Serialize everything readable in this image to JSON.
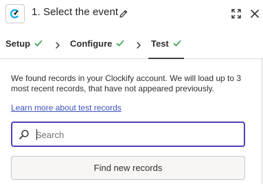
{
  "header": {
    "title": "1. Select the event",
    "app_icon": "clockify-logo-icon",
    "edit_icon": "pencil-icon",
    "expand_icon": "expand-icon",
    "close_icon": "close-icon"
  },
  "steps": [
    {
      "label": "Setup",
      "status": "complete"
    },
    {
      "label": "Configure",
      "status": "complete"
    },
    {
      "label": "Test",
      "status": "complete",
      "active": true
    }
  ],
  "colors": {
    "accent": "#503ebd",
    "check": "#2f9e44",
    "link": "#3d4fbc"
  },
  "test": {
    "description": "We found records in your Clockify account. We will load up to 3 most recent records, that have not appeared previously.",
    "learn_more": "Learn more about test records",
    "search_placeholder": "Search",
    "find_button": "Find new records"
  }
}
